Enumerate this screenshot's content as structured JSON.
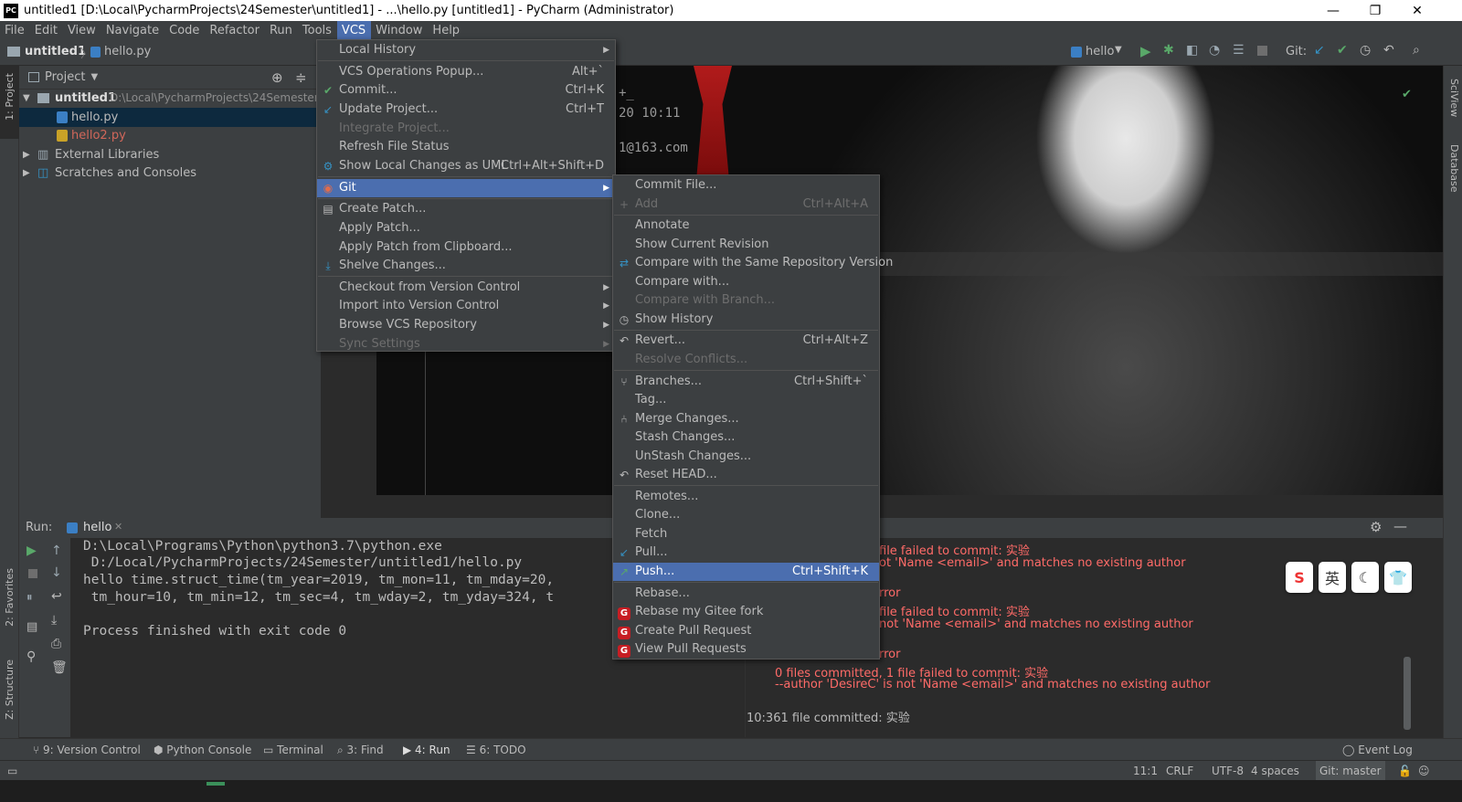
{
  "window": {
    "title": "untitled1 [D:\\Local\\PycharmProjects\\24Semester\\untitled1] - ...\\hello.py [untitled1] - PyCharm (Administrator)",
    "logo_text": "PC",
    "minimize": "—",
    "restore": "❐",
    "close": "✕"
  },
  "menubar": [
    "File",
    "Edit",
    "View",
    "Navigate",
    "Code",
    "Refactor",
    "Run",
    "Tools",
    "VCS",
    "Window",
    "Help"
  ],
  "navbar": {
    "project": "untitled1",
    "file": "hello.py",
    "run_config": "hello",
    "git_label": "Git:"
  },
  "project_panel": {
    "title": "Project",
    "root_name": "untitled1",
    "root_path": "D:\\Local\\PycharmProjects\\24Semester\\u",
    "files": [
      "hello.py",
      "hello2.py"
    ],
    "external": "External Libraries",
    "scratches": "Scratches and Consoles"
  },
  "editor_text": {
    "line1": "+_",
    "line2": "20 10:11",
    "line3": "1@163.com"
  },
  "side_labels": {
    "project": "1: Project",
    "favorites": "2: Favorites",
    "structure": "Z: Structure",
    "sciview": "SciView",
    "database": "Database"
  },
  "run": {
    "label": "Run:",
    "tab": "hello",
    "console": [
      "D:\\Local\\Programs\\Python\\python3.7\\python.exe",
      " D:/Local/PycharmProjects/24Semester/untitled1/hello.py",
      "hello time.struct_time(tm_year=2019, tm_mon=11, tm_mday=20,",
      " tm_hour=10, tm_min=12, tm_sec=4, tm_wday=2, tm_yday=324, t",
      "",
      "Process finished with exit code 0"
    ]
  },
  "vcs_log": {
    "lines": [
      "file failed to commit: 实验",
      "ot 'Name <email>' and matches no existing author",
      "rror",
      "file failed to commit: 实验",
      "not 'Name <email>' and matches no existing author",
      "rror",
      "0 files committed, 1 file failed to commit: 实验",
      "--author 'DesireC' is not 'Name <email>' and matches no existing author"
    ],
    "last": "10:361 file committed: 实验"
  },
  "vcs_menu": {
    "items": [
      {
        "label": "Local History",
        "shortcut": "",
        "submenu": true
      },
      {
        "sep": true
      },
      {
        "label": "VCS Operations Popup...",
        "shortcut": "Alt+`"
      },
      {
        "label": "Commit...",
        "shortcut": "Ctrl+K",
        "icon": "check-icon"
      },
      {
        "label": "Update Project...",
        "shortcut": "Ctrl+T",
        "icon": "update-arrow-icon"
      },
      {
        "label": "Integrate Project...",
        "shortcut": "",
        "disabled": true
      },
      {
        "label": "Refresh File Status",
        "shortcut": ""
      },
      {
        "label": "Show Local Changes as UML",
        "shortcut": "Ctrl+Alt+Shift+D",
        "icon": "uml-icon"
      },
      {
        "sep": true
      },
      {
        "label": "Git",
        "shortcut": "",
        "submenu": true,
        "highlight": true,
        "icon": "git-icon"
      },
      {
        "sep": true
      },
      {
        "label": "Create Patch...",
        "shortcut": "",
        "icon": "patch-icon"
      },
      {
        "label": "Apply Patch...",
        "shortcut": ""
      },
      {
        "label": "Apply Patch from Clipboard...",
        "shortcut": ""
      },
      {
        "label": "Shelve Changes...",
        "shortcut": "",
        "icon": "shelve-icon"
      },
      {
        "sep": true
      },
      {
        "label": "Checkout from Version Control",
        "shortcut": "",
        "submenu": true
      },
      {
        "label": "Import into Version Control",
        "shortcut": "",
        "submenu": true
      },
      {
        "label": "Browse VCS Repository",
        "shortcut": "",
        "submenu": true
      },
      {
        "label": "Sync Settings",
        "shortcut": "",
        "submenu": true,
        "disabled": true
      }
    ]
  },
  "git_menu": {
    "items": [
      {
        "label": "Commit File...",
        "shortcut": ""
      },
      {
        "label": "Add",
        "shortcut": "Ctrl+Alt+A",
        "disabled": true,
        "icon": "plus-icon"
      },
      {
        "sep": true
      },
      {
        "label": "Annotate",
        "shortcut": ""
      },
      {
        "label": "Show Current Revision",
        "shortcut": ""
      },
      {
        "label": "Compare with the Same Repository Version",
        "shortcut": "",
        "icon": "compare-icon"
      },
      {
        "label": "Compare with...",
        "shortcut": ""
      },
      {
        "label": "Compare with Branch...",
        "shortcut": "",
        "disabled": true
      },
      {
        "label": "Show History",
        "shortcut": "",
        "icon": "history-icon"
      },
      {
        "sep": true
      },
      {
        "label": "Revert...",
        "shortcut": "Ctrl+Alt+Z",
        "icon": "revert-icon"
      },
      {
        "label": "Resolve Conflicts...",
        "shortcut": "",
        "disabled": true
      },
      {
        "sep": true
      },
      {
        "label": "Branches...",
        "shortcut": "Ctrl+Shift+`",
        "icon": "branch-icon"
      },
      {
        "label": "Tag...",
        "shortcut": ""
      },
      {
        "label": "Merge Changes...",
        "shortcut": "",
        "icon": "merge-icon"
      },
      {
        "label": "Stash Changes...",
        "shortcut": ""
      },
      {
        "label": "UnStash Changes...",
        "shortcut": ""
      },
      {
        "label": "Reset HEAD...",
        "shortcut": "",
        "icon": "reset-icon"
      },
      {
        "sep": true
      },
      {
        "label": "Remotes...",
        "shortcut": ""
      },
      {
        "label": "Clone...",
        "shortcut": ""
      },
      {
        "label": "Fetch",
        "shortcut": ""
      },
      {
        "label": "Pull...",
        "shortcut": "",
        "icon": "pull-icon"
      },
      {
        "label": "Push...",
        "shortcut": "Ctrl+Shift+K",
        "highlight": true,
        "icon": "push-icon"
      },
      {
        "sep": true
      },
      {
        "label": "Rebase...",
        "shortcut": ""
      },
      {
        "label": "Rebase my Gitee fork",
        "shortcut": "",
        "icon": "gitee-icon"
      },
      {
        "label": "Create Pull Request",
        "shortcut": "",
        "icon": "gitee-icon"
      },
      {
        "label": "View Pull Requests",
        "shortcut": "",
        "icon": "gitee-icon"
      }
    ]
  },
  "bottom_tools": [
    "9: Version Control",
    "Python Console",
    "Terminal",
    "3: Find",
    "4: Run",
    "6: TODO",
    "Event Log"
  ],
  "status": {
    "position": "11:1",
    "line_sep": "CRLF",
    "encoding": "UTF-8",
    "indent": "4 spaces",
    "branch": "Git: master"
  },
  "ime": [
    "S",
    "英",
    "☾",
    "👕"
  ],
  "colors": {
    "accent": "#4b6eaf",
    "error": "#ff6b68",
    "panel": "#3c3f41",
    "editor": "#2b2b2b"
  }
}
